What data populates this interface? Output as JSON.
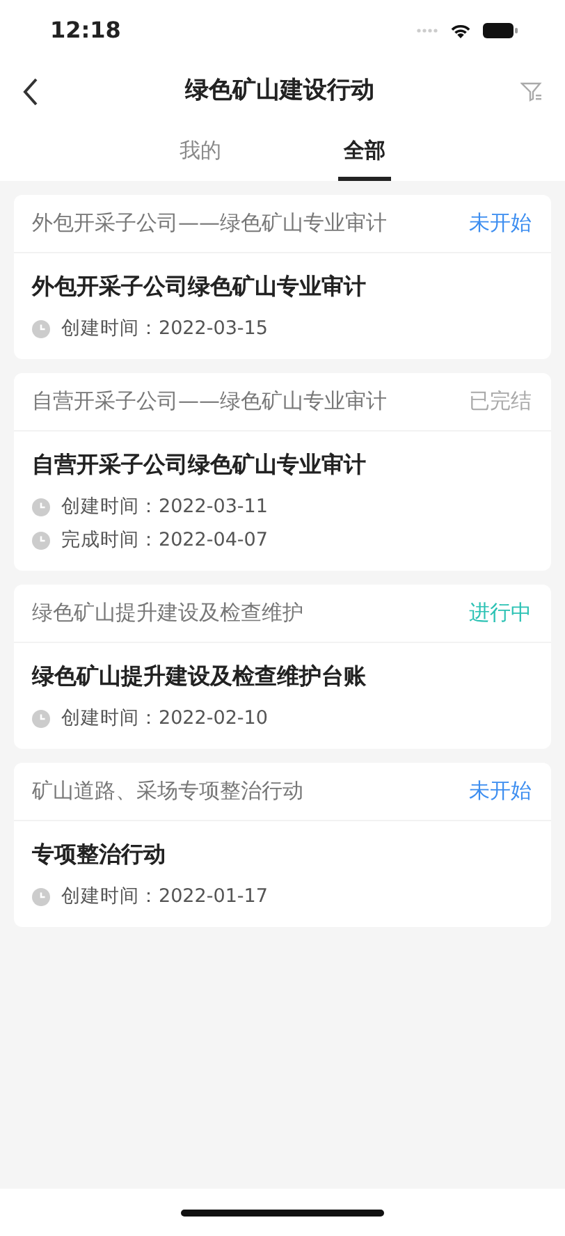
{
  "status_bar": {
    "time": "12:18"
  },
  "nav": {
    "title": "绿色矿山建设行动"
  },
  "tabs": [
    {
      "label": "我的",
      "selected": false
    },
    {
      "label": "全部",
      "selected": true
    }
  ],
  "cards": [
    {
      "group": "外包开采子公司——绿色矿山专业审计",
      "status": "未开始",
      "color": "#3d8ef0",
      "title": "外包开采子公司绿色矿山专业审计",
      "times": [
        "创建时间：2022-03-15"
      ]
    },
    {
      "group": "自营开采子公司——绿色矿山专业审计",
      "status": "已完结",
      "color": "#a8a8a8",
      "title": "自营开采子公司绿色矿山专业审计",
      "times": [
        "创建时间：2022-03-11",
        "完成时间：2022-04-07"
      ]
    },
    {
      "group": "绿色矿山提升建设及检查维护",
      "status": "进行中",
      "color": "#2cc2b4",
      "title": "绿色矿山提升建设及检查维护台账",
      "times": [
        "创建时间：2022-02-10"
      ]
    },
    {
      "group": "矿山道路、采场专项整治行动",
      "status": "未开始",
      "color": "#3d8ef0",
      "title": "专项整治行动",
      "times": [
        "创建时间：2022-01-17"
      ]
    }
  ]
}
